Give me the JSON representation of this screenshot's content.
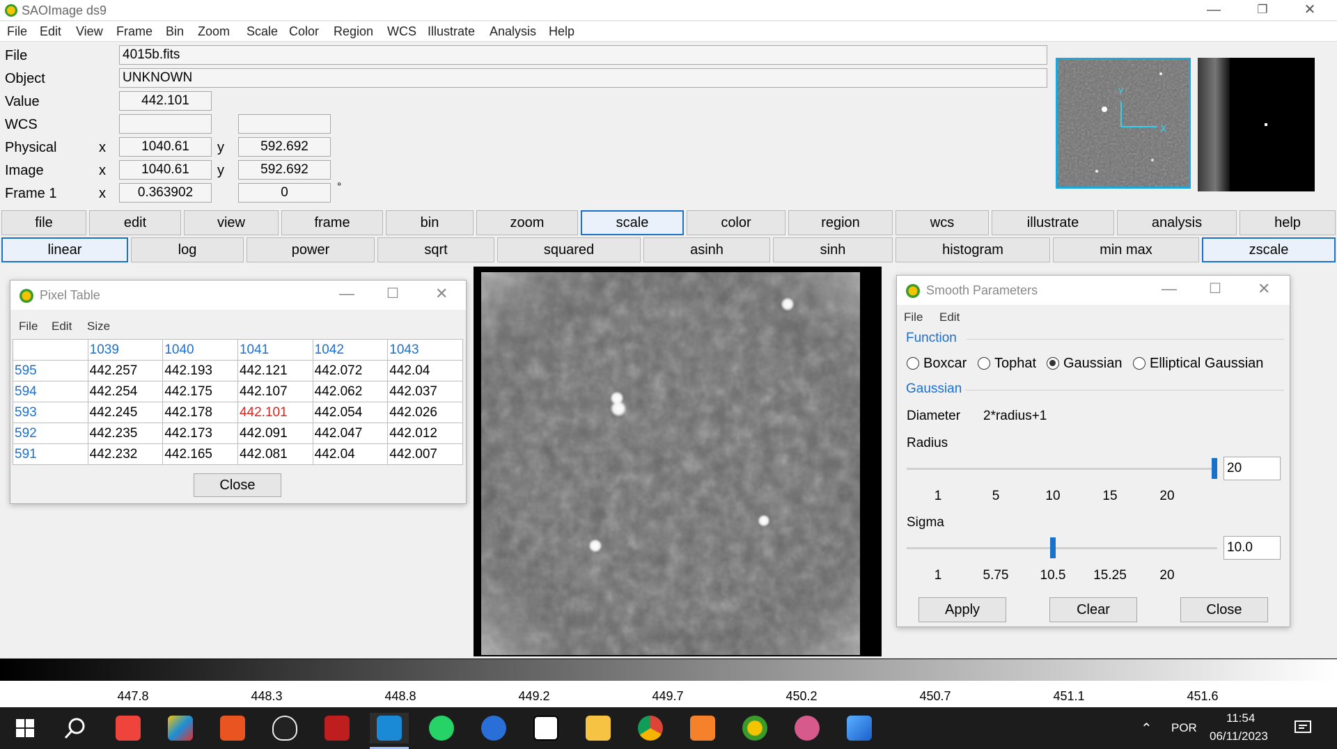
{
  "window": {
    "title": "SAOImage ds9"
  },
  "menubar": [
    "File",
    "Edit",
    "View",
    "Frame",
    "Bin",
    "Zoom",
    "Scale",
    "Color",
    "Region",
    "WCS",
    "Illustrate",
    "Analysis",
    "Help"
  ],
  "info": {
    "file_label": "File",
    "file_value": "4015b.fits",
    "object_label": "Object",
    "object_value": "UNKNOWN",
    "value_label": "Value",
    "value_value": "442.101",
    "wcs_label": "WCS",
    "wcs_x": "",
    "wcs_y": "",
    "physical_label": "Physical",
    "physical_x": "1040.61",
    "physical_y": "592.692",
    "image_label": "Image",
    "image_x": "1040.61",
    "image_y": "592.692",
    "frame_label": "Frame 1",
    "frame_x": "0.363902",
    "frame_y": "0",
    "degree": "°",
    "x": "x",
    "y": "y"
  },
  "buttonbar": {
    "main": [
      "file",
      "edit",
      "view",
      "frame",
      "bin",
      "zoom",
      "scale",
      "color",
      "region",
      "wcs",
      "illustrate",
      "analysis",
      "help"
    ],
    "main_selected": "scale",
    "scale": [
      "linear",
      "log",
      "power",
      "sqrt",
      "squared",
      "asinh",
      "sinh",
      "histogram",
      "min max",
      "zscale"
    ],
    "scale_selected": [
      "linear",
      "zscale"
    ]
  },
  "panner": {
    "axis_y": "Y",
    "axis_x": "X"
  },
  "pixel_table": {
    "title": "Pixel Table",
    "menu": [
      "File",
      "Edit",
      "Size"
    ],
    "columns": [
      "",
      "1039",
      "1040",
      "1041",
      "1042",
      "1043"
    ],
    "rows": [
      [
        "595",
        "442.257",
        "442.193",
        "442.121",
        "442.072",
        "442.04"
      ],
      [
        "594",
        "442.254",
        "442.175",
        "442.107",
        "442.062",
        "442.037"
      ],
      [
        "593",
        "442.245",
        "442.178",
        "442.101",
        "442.054",
        "442.026"
      ],
      [
        "592",
        "442.235",
        "442.173",
        "442.091",
        "442.047",
        "442.012"
      ],
      [
        "591",
        "442.232",
        "442.165",
        "442.081",
        "442.04",
        "442.007"
      ]
    ],
    "highlight": {
      "row": 2,
      "col": 3
    },
    "close_label": "Close"
  },
  "smooth": {
    "title": "Smooth Parameters",
    "menu": [
      "File",
      "Edit"
    ],
    "function_head": "Function",
    "functions": [
      "Boxcar",
      "Tophat",
      "Gaussian",
      "Elliptical Gaussian"
    ],
    "function_selected": "Gaussian",
    "gaussian_head": "Gaussian",
    "diameter_label": "Diameter",
    "diameter_value": "2*radius+1",
    "radius_label": "Radius",
    "radius_value": "20",
    "radius_level": 1.0,
    "radius_ticks": [
      "1",
      "5",
      "10",
      "15",
      "20"
    ],
    "sigma_label": "Sigma",
    "sigma_value": "10.0",
    "sigma_level": 0.47,
    "sigma_ticks": [
      "1",
      "5.75",
      "10.5",
      "15.25",
      "20"
    ],
    "apply_label": "Apply",
    "clear_label": "Clear",
    "close_label": "Close"
  },
  "colorbar": {
    "labels": [
      "447.8",
      "448.3",
      "448.8",
      "449.2",
      "449.7",
      "450.2",
      "450.7",
      "451.1",
      "451.6"
    ]
  },
  "taskbar": {
    "apps": [
      "start-icon",
      "search-icon",
      "anydesk-icon",
      "git-icon",
      "ubuntu-icon",
      "linux-icon",
      "filezilla-icon",
      "vscode-icon",
      "whatsapp-icon",
      "thunderbird-icon",
      "notion-icon",
      "explorer-icon",
      "chrome-icon",
      "pdf-icon",
      "ds9-icon",
      "ds9-alt-icon",
      "photos-icon"
    ],
    "lang": "POR",
    "time": "11:54",
    "date": "06/11/2023"
  }
}
